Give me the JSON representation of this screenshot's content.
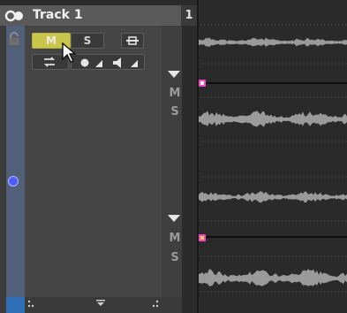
{
  "track": {
    "title": "Track 1",
    "number": "1"
  },
  "buttons": {
    "mute": "M",
    "solo": "S"
  },
  "lanes": [
    {
      "mute": "M",
      "solo": "S"
    },
    {
      "mute": "M",
      "solo": "S"
    }
  ],
  "colors": {
    "mute_active": "#c9c44a",
    "track_accent": "#525f78",
    "selection_blue": "#2f6fb8",
    "marker": "#ff44cc",
    "waveform": "#9a9a9a"
  }
}
